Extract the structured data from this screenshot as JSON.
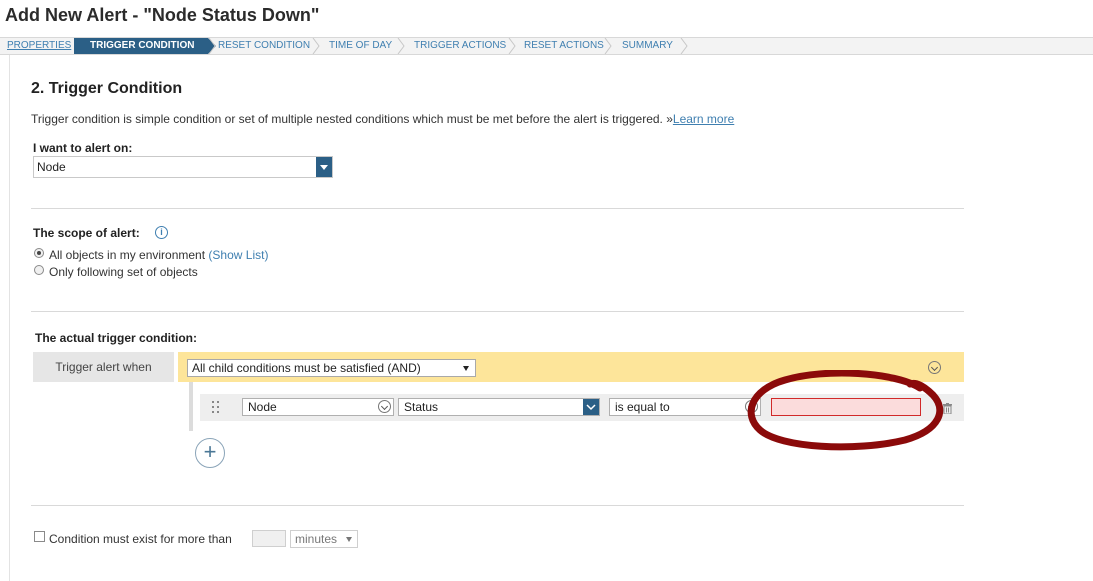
{
  "page": {
    "title": "Add New Alert - \"Node Status Down\""
  },
  "wizard": {
    "steps": [
      {
        "label": "PROPERTIES",
        "state": "done"
      },
      {
        "label": "TRIGGER CONDITION",
        "state": "active"
      },
      {
        "label": "RESET CONDITION",
        "state": "pending"
      },
      {
        "label": "TIME OF DAY",
        "state": "pending"
      },
      {
        "label": "TRIGGER ACTIONS",
        "state": "pending"
      },
      {
        "label": "RESET ACTIONS",
        "state": "pending"
      },
      {
        "label": "SUMMARY",
        "state": "pending"
      }
    ],
    "active_color": "#2b5f86"
  },
  "section": {
    "title": "2. Trigger Condition",
    "description": "Trigger condition is simple condition or set of multiple nested conditions which must be met before the alert is triggered. »",
    "learn_more": "Learn more"
  },
  "alert_on": {
    "label": "I want to alert on:",
    "value": "Node"
  },
  "scope": {
    "label": "The scope of alert:",
    "info_icon": "info-icon",
    "options": [
      {
        "label": "All objects in my environment",
        "link": "(Show List)",
        "selected": true
      },
      {
        "label": "Only following set of objects",
        "selected": false
      }
    ]
  },
  "trigger": {
    "label": "The actual trigger condition:",
    "when_label": "Trigger alert when",
    "group_operator": "All child conditions must be satisfied (AND)",
    "condition": {
      "object": "Node",
      "field": "Status",
      "operator": "is equal to",
      "value": ""
    },
    "add_icon": "plus-icon",
    "bar_color": "#fde59a"
  },
  "duration": {
    "label": "Condition must exist for more than",
    "value": "",
    "unit": "minutes",
    "checked": false
  },
  "annotation": {
    "color": "#8b0a0a"
  }
}
